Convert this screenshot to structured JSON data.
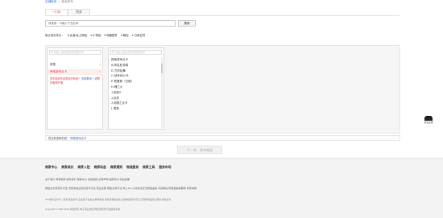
{
  "breadcrumb": {
    "home": "店铺首页",
    "sep": ">",
    "current": "商品发布"
  },
  "tabs": [
    {
      "label": "一口价"
    },
    {
      "label": "拍卖"
    }
  ],
  "search": {
    "placeholder": "请搜索：可输入产品名称",
    "button": "搜索"
  },
  "recent": {
    "label": "最近使用类目：",
    "items": [
      "5-女装/女士精品",
      "4-小饰品",
      "3-电脑配件",
      "2-箱包",
      "1-日用百货"
    ]
  },
  "category_col1": {
    "search_placeholder": "请输入类目名称/拼音首字母",
    "items": [
      {
        "label": "其他"
      },
      {
        "label": "网络游戏点卡"
      }
    ],
    "note_prefix": "您不能发布该类目的商品？",
    "note_link": "查看要求 >",
    "note_suffix": "或联系客服开通"
  },
  "category_col2": {
    "search_placeholder": "请输入类目名称/拼音首字母",
    "items": [
      "网络游戏点卡",
      "A-阿克尼领域",
      "D-刀剑乱舞",
      "C-创世战士OL",
      "E-恶魔城（日版）",
      "H-魂之火",
      "J-剑侠3",
      "J-剑灵",
      "J-剑魔之点卡",
      "L-零秒"
    ]
  },
  "chosen": {
    "label": "您当前选择的是：",
    "value": "网络游戏点卡"
  },
  "next_button": "下一步，发布商品",
  "help": {
    "label": "意见反馈"
  },
  "footer": {
    "nav": [
      "商家中心",
      "商家成长",
      "商家入驻",
      "商家动态",
      "商家规则",
      "物流服务",
      "商家工具",
      "服务市场"
    ],
    "line1": "关于我们   商家服务   联系我们   帮助中心   友情链接   法律声明   诚聘英才   隐私政策",
    "line2": "网络文化经营许可证   增值电信业务经营许可证   营业执照   网络交易平台   网上110   公共信息安全网络监察   可信网站   网络警察提醒你   有奖举报",
    "line3": "ICP备案证书号   公安机关备案号   违法和不良信息举报电话   消费者维权热线   出版物经营许可证   互联网药品信息服务资格证书",
    "line4": "Copyright © 2004-2024 版权所有   电子营业执照   网络游戏防沉迷健康系统"
  }
}
